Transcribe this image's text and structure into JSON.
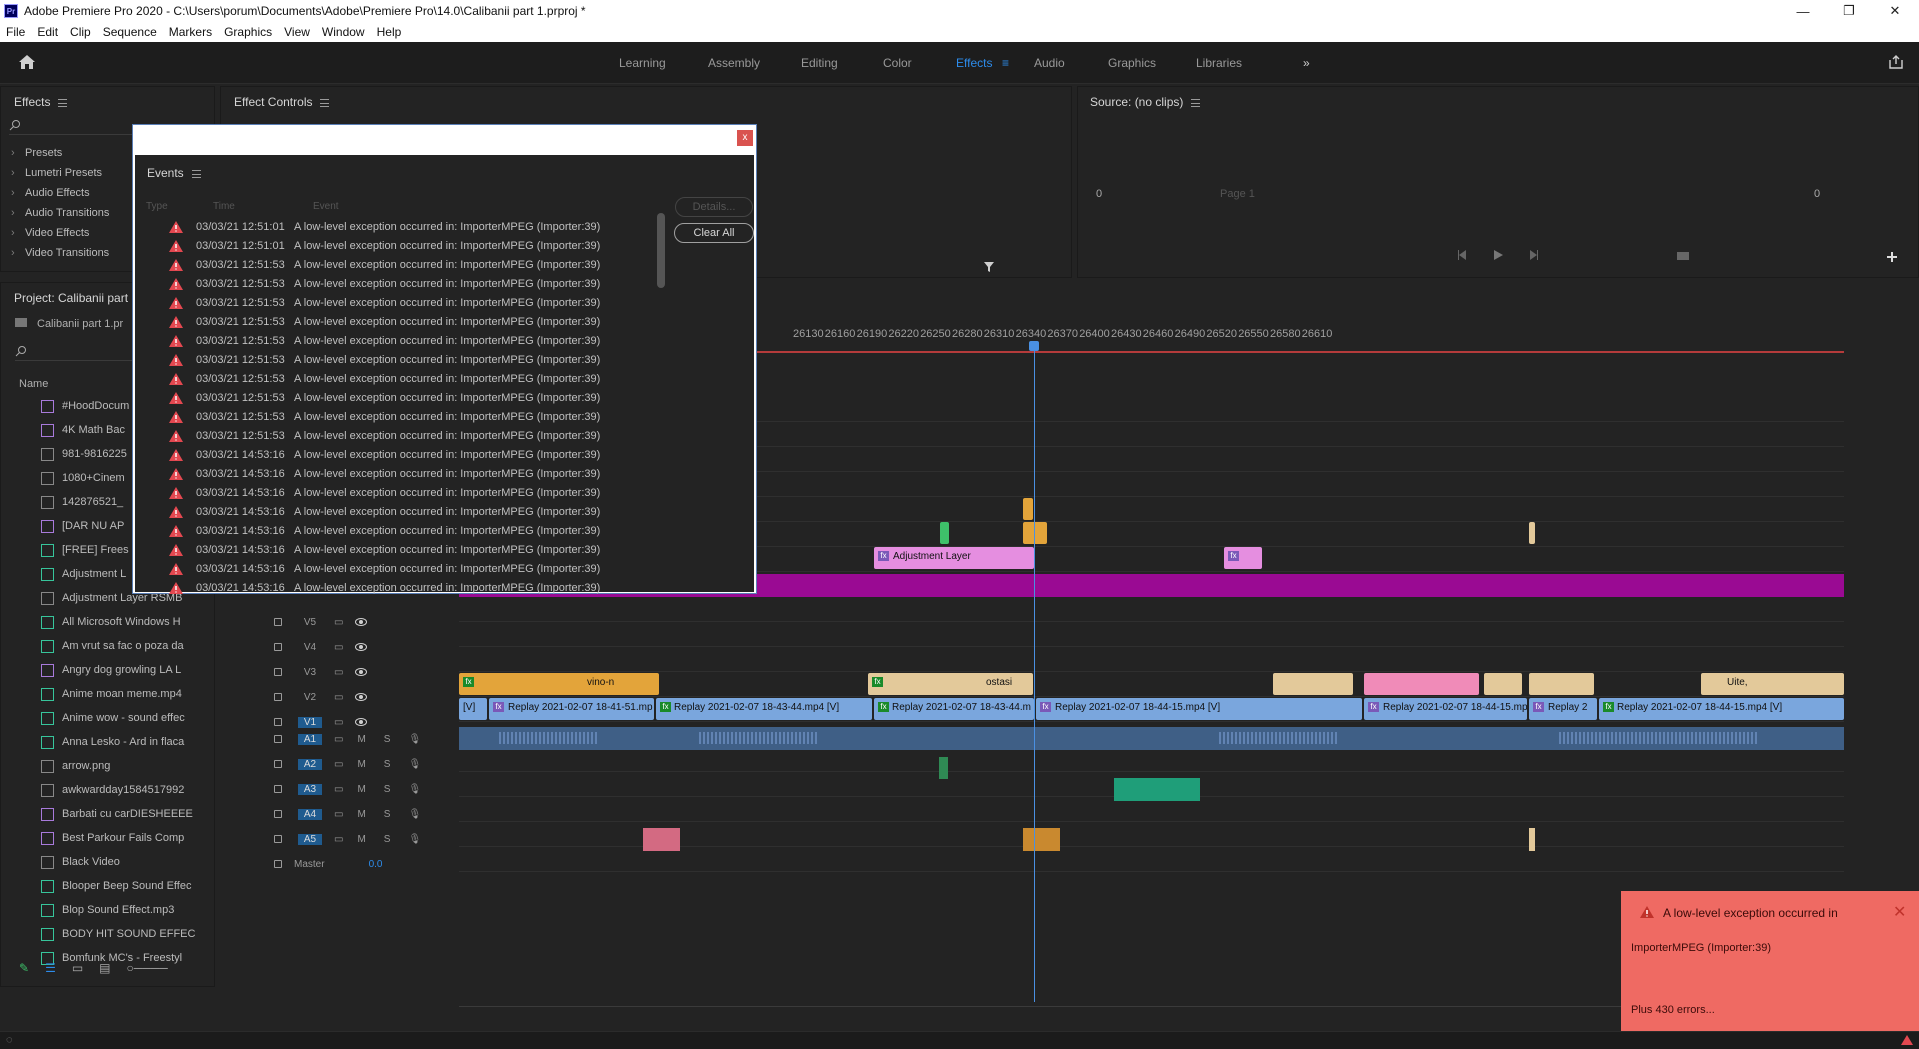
{
  "app": {
    "title": "Adobe Premiere Pro 2020 - C:\\Users\\porum\\Documents\\Adobe\\Premiere Pro\\14.0\\Calibanii part 1.prproj *",
    "icon": "Pr"
  },
  "menu": [
    "File",
    "Edit",
    "Clip",
    "Sequence",
    "Markers",
    "Graphics",
    "View",
    "Window",
    "Help"
  ],
  "workspaces": [
    "Learning",
    "Assembly",
    "Editing",
    "Color",
    "Effects",
    "Audio",
    "Graphics",
    "Libraries"
  ],
  "active_workspace": "Effects",
  "effects_panel": {
    "title": "Effects",
    "items": [
      "Presets",
      "Lumetri Presets",
      "Audio Effects",
      "Audio Transitions",
      "Video Effects",
      "Video Transitions"
    ]
  },
  "effect_controls": {
    "title": "Effect Controls"
  },
  "source_panel": {
    "title": "Source: (no clips)",
    "left_value": "0",
    "right_value": "0",
    "page": "Page 1"
  },
  "project_panel": {
    "title": "Project: Calibanii part 1",
    "file": "Calibanii part 1.pr",
    "column": "Name",
    "items": [
      {
        "name": "#HoodDocum",
        "type": "img"
      },
      {
        "name": "4K Math Bac",
        "type": "img"
      },
      {
        "name": "981-9816225",
        "type": "file"
      },
      {
        "name": "1080+Cinem",
        "type": "file"
      },
      {
        "name": "142876521_",
        "type": "file"
      },
      {
        "name": "[DAR NU AP",
        "type": "img"
      },
      {
        "name": "[FREE] Frees",
        "type": "seq"
      },
      {
        "name": "Adjustment L",
        "type": "seq"
      },
      {
        "name": "Adjustment Layer RSMB",
        "type": "file"
      },
      {
        "name": "All Microsoft Windows H",
        "type": "seq"
      },
      {
        "name": "Am vrut sa fac o poza da",
        "type": "seq"
      },
      {
        "name": "Angry dog growling LA L",
        "type": "img"
      },
      {
        "name": "Anime moan meme.mp4",
        "type": "seq"
      },
      {
        "name": "Anime wow - sound effec",
        "type": "seq"
      },
      {
        "name": "Anna Lesko - Ard in flaca",
        "type": "seq"
      },
      {
        "name": "arrow.png",
        "type": "file"
      },
      {
        "name": "awkwardday1584517992",
        "type": "file"
      },
      {
        "name": "Barbati cu carDIESHEEEE",
        "type": "img"
      },
      {
        "name": "Best Parkour Fails Comp",
        "type": "img"
      },
      {
        "name": "Black Video",
        "type": "file"
      },
      {
        "name": "Blooper Beep Sound Effec",
        "type": "seq"
      },
      {
        "name": "Blop Sound Effect.mp3",
        "type": "seq"
      },
      {
        "name": "BODY HIT SOUND EFFEC",
        "type": "seq"
      },
      {
        "name": "Bomfunk MC's - Freestyl",
        "type": "seq"
      }
    ]
  },
  "ruler": [
    "26130",
    "26160",
    "26190",
    "26220",
    "26250",
    "26280",
    "26310",
    "26340",
    "26370",
    "26400",
    "26430",
    "26460",
    "26490",
    "26520",
    "26550",
    "26580",
    "26610"
  ],
  "tracks": {
    "video": [
      "V5",
      "V4",
      "V3",
      "V2",
      "V1"
    ],
    "audio": [
      "A1",
      "A2",
      "A3",
      "A4",
      "A5"
    ],
    "master": "Master",
    "master_value": "0.0",
    "toggles": [
      "M",
      "S"
    ]
  },
  "clips": {
    "adjustment": "Adjustment Layer",
    "v2_a": "vino-n",
    "v2_b": "ostasi",
    "v2_c": "Uite,",
    "v1_a": "[V]",
    "v1_b": "Replay 2021-02-07 18-41-51.mp",
    "v1_c": "Replay 2021-02-07 18-43-44.mp4 [V]",
    "v1_d": "Replay 2021-02-07 18-43-44.m",
    "v1_e": "Replay 2021-02-07 18-44-15.mp4 [V]",
    "v1_f": "Replay 2021-02-07 18-44-15.mp",
    "v1_g": "Replay 2",
    "v1_h": "Replay 2021-02-07 18-44-15.mp4 [V]"
  },
  "events_dialog": {
    "title": "Events",
    "columns": [
      "Type",
      "Time",
      "Event"
    ],
    "details_button": "Details...",
    "clear_button": "Clear All",
    "close": "x",
    "rows": [
      {
        "time": "03/03/21 12:51:01",
        "msg": "A low-level exception occurred in: ImporterMPEG (Importer:39)"
      },
      {
        "time": "03/03/21 12:51:01",
        "msg": "A low-level exception occurred in: ImporterMPEG (Importer:39)"
      },
      {
        "time": "03/03/21 12:51:53",
        "msg": "A low-level exception occurred in: ImporterMPEG (Importer:39)"
      },
      {
        "time": "03/03/21 12:51:53",
        "msg": "A low-level exception occurred in: ImporterMPEG (Importer:39)"
      },
      {
        "time": "03/03/21 12:51:53",
        "msg": "A low-level exception occurred in: ImporterMPEG (Importer:39)"
      },
      {
        "time": "03/03/21 12:51:53",
        "msg": "A low-level exception occurred in: ImporterMPEG (Importer:39)"
      },
      {
        "time": "03/03/21 12:51:53",
        "msg": "A low-level exception occurred in: ImporterMPEG (Importer:39)"
      },
      {
        "time": "03/03/21 12:51:53",
        "msg": "A low-level exception occurred in: ImporterMPEG (Importer:39)"
      },
      {
        "time": "03/03/21 12:51:53",
        "msg": "A low-level exception occurred in: ImporterMPEG (Importer:39)"
      },
      {
        "time": "03/03/21 12:51:53",
        "msg": "A low-level exception occurred in: ImporterMPEG (Importer:39)"
      },
      {
        "time": "03/03/21 12:51:53",
        "msg": "A low-level exception occurred in: ImporterMPEG (Importer:39)"
      },
      {
        "time": "03/03/21 12:51:53",
        "msg": "A low-level exception occurred in: ImporterMPEG (Importer:39)"
      },
      {
        "time": "03/03/21 14:53:16",
        "msg": "A low-level exception occurred in: ImporterMPEG (Importer:39)"
      },
      {
        "time": "03/03/21 14:53:16",
        "msg": "A low-level exception occurred in: ImporterMPEG (Importer:39)"
      },
      {
        "time": "03/03/21 14:53:16",
        "msg": "A low-level exception occurred in: ImporterMPEG (Importer:39)"
      },
      {
        "time": "03/03/21 14:53:16",
        "msg": "A low-level exception occurred in: ImporterMPEG (Importer:39)"
      },
      {
        "time": "03/03/21 14:53:16",
        "msg": "A low-level exception occurred in: ImporterMPEG (Importer:39)"
      },
      {
        "time": "03/03/21 14:53:16",
        "msg": "A low-level exception occurred in: ImporterMPEG (Importer:39)"
      },
      {
        "time": "03/03/21 14:53:16",
        "msg": "A low-level exception occurred in: ImporterMPEG (Importer:39)"
      },
      {
        "time": "03/03/21 14:53:16",
        "msg": "A low-level exception occurred in: ImporterMPEG (Importer:39)"
      }
    ]
  },
  "toast": {
    "title": "A low-level exception occurred in",
    "body": "ImporterMPEG (Importer:39)",
    "more": "Plus 430 errors..."
  },
  "colors": {
    "accent": "#2d8ceb",
    "toast": "#ef6a63",
    "v1_clip": "#7aa6dd",
    "v2_clip": "#e3c99a",
    "adjustment": "#e58ee0",
    "magenta_track": "#9a0a93",
    "playhead": "#4a90e2"
  }
}
